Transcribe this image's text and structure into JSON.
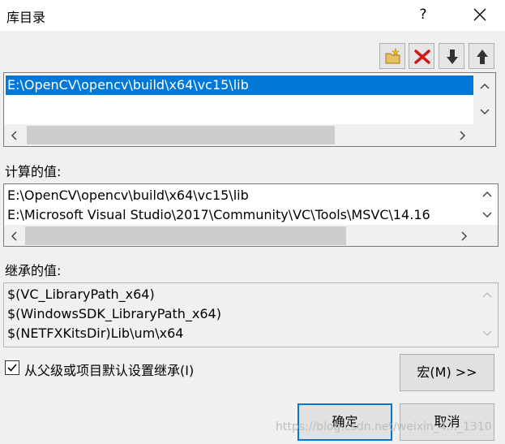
{
  "window": {
    "title": "库目录",
    "help": "?"
  },
  "list": {
    "items": [
      "E:\\OpenCV\\opencv\\build\\x64\\vc15\\lib"
    ]
  },
  "computed": {
    "label": "计算的值:",
    "lines": [
      "E:\\OpenCV\\opencv\\build\\x64\\vc15\\lib",
      "E:\\Microsoft Visual Studio\\2017\\Community\\VC\\Tools\\MSVC\\14.16"
    ]
  },
  "inherited": {
    "label": "继承的值:",
    "lines": [
      "$(VC_LibraryPath_x64)",
      "$(WindowsSDK_LibraryPath_x64)",
      "$(NETFXKitsDir)Lib\\um\\x64"
    ]
  },
  "inherit_checkbox": {
    "label": "从父级或项目默认设置继承(I)",
    "checked": true
  },
  "buttons": {
    "macro": "宏(M) >>",
    "ok": "确定",
    "cancel": "取消"
  },
  "watermark": "https://blog.csdn.net/weixin_4..._1310"
}
